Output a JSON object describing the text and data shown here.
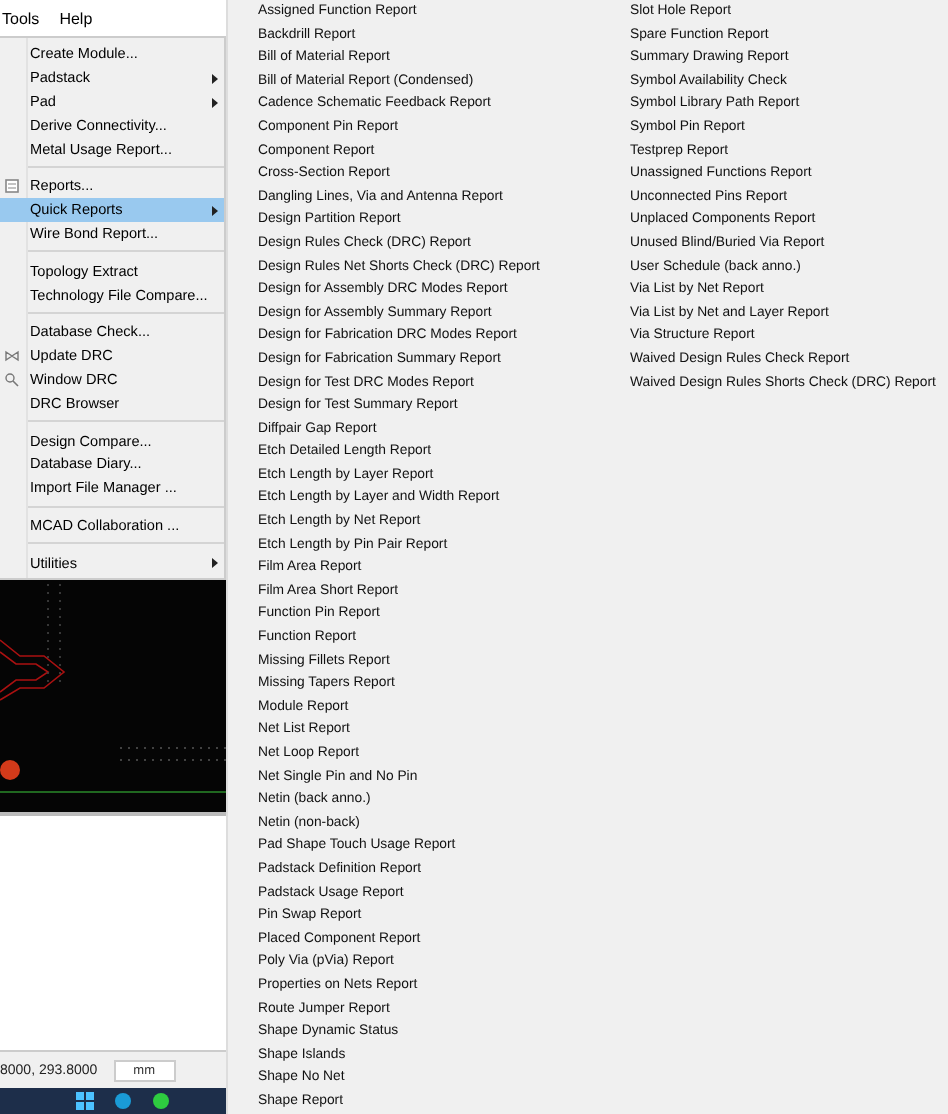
{
  "menubar": [
    {
      "label": "Tools"
    },
    {
      "label": "Help"
    }
  ],
  "tools_menu": {
    "groups": [
      [
        {
          "label": "Create Module...",
          "submenu": false,
          "selected": false,
          "has_icon": false
        },
        {
          "label": "Padstack",
          "submenu": true,
          "selected": false,
          "has_icon": false
        },
        {
          "label": "Pad",
          "submenu": true,
          "selected": false,
          "has_icon": false
        },
        {
          "label": "Derive Connectivity...",
          "submenu": false,
          "selected": false,
          "has_icon": false
        },
        {
          "label": "Metal Usage Report...",
          "submenu": false,
          "selected": false,
          "has_icon": false
        }
      ],
      [
        {
          "label": "Reports...",
          "submenu": false,
          "selected": false,
          "has_icon": true
        },
        {
          "label": "Quick Reports",
          "submenu": true,
          "selected": true,
          "has_icon": false
        },
        {
          "label": "Wire Bond Report...",
          "submenu": false,
          "selected": false,
          "has_icon": false
        }
      ],
      [
        {
          "label": "Topology Extract",
          "submenu": false,
          "selected": false,
          "has_icon": false
        },
        {
          "label": "Technology File Compare...",
          "submenu": false,
          "selected": false,
          "has_icon": false
        }
      ],
      [
        {
          "label": "Database Check...",
          "submenu": false,
          "selected": false,
          "has_icon": false
        },
        {
          "label": "Update DRC",
          "submenu": false,
          "selected": false,
          "has_icon": true
        },
        {
          "label": "Window DRC",
          "submenu": false,
          "selected": false,
          "has_icon": true
        },
        {
          "label": "DRC Browser",
          "submenu": false,
          "selected": false,
          "has_icon": false
        }
      ],
      [
        {
          "label": "Design Compare...",
          "submenu": false,
          "selected": false,
          "has_icon": false
        },
        {
          "label": "Database Diary...",
          "submenu": false,
          "selected": false,
          "has_icon": false
        },
        {
          "label": "Import File Manager ...",
          "submenu": false,
          "selected": false,
          "has_icon": false
        }
      ],
      [
        {
          "label": "MCAD Collaboration ...",
          "submenu": false,
          "selected": false,
          "has_icon": false
        }
      ],
      [
        {
          "label": "Utilities",
          "submenu": true,
          "selected": false,
          "has_icon": false
        }
      ]
    ]
  },
  "quick_reports": {
    "columns": [
      [
        "Assigned Function Report",
        "Backdrill Report",
        "Bill of Material Report",
        "Bill of Material Report (Condensed)",
        "Cadence Schematic Feedback Report",
        "Component Pin Report",
        "Component Report",
        "Cross-Section Report",
        "Dangling Lines, Via and Antenna Report",
        "Design Partition Report",
        "Design Rules Check (DRC) Report",
        "Design Rules Net Shorts Check (DRC) Report",
        "Design for Assembly DRC Modes Report",
        "Design for Assembly Summary Report",
        "Design for Fabrication DRC Modes Report",
        "Design for Fabrication Summary Report",
        "Design for Test DRC Modes Report",
        "Design for Test Summary Report",
        "Diffpair Gap Report",
        "Etch Detailed Length Report",
        "Etch Length by Layer Report",
        "Etch Length by Layer and Width Report",
        "Etch Length by Net Report",
        "Etch Length by Pin Pair Report",
        "Film Area Report",
        "Film Area Short Report",
        "Function Pin Report",
        "Function Report",
        "Missing Fillets Report",
        "Missing Tapers Report",
        "Module Report",
        "Net List Report",
        "Net Loop Report",
        "Net Single Pin and No Pin",
        "Netin (back anno.)",
        "Netin (non-back)",
        "Pad Shape Touch Usage Report",
        "Padstack Definition Report",
        "Padstack Usage Report",
        "Pin Swap Report",
        "Placed Component Report",
        "Poly Via (pVia) Report",
        "Properties on Nets Report",
        "Route Jumper Report",
        "Shape Dynamic Status",
        "Shape Islands",
        "Shape No Net",
        "Shape Report"
      ],
      [
        "Slot Hole Report",
        "Spare Function Report",
        "Summary Drawing Report",
        "Symbol Availability Check",
        "Symbol Library Path Report",
        "Symbol Pin Report",
        "Testprep Report",
        "Unassigned Functions Report",
        "Unconnected Pins Report",
        "Unplaced Components Report",
        "Unused Blind/Buried Via Report",
        "User Schedule (back anno.)",
        "Via List by Net Report",
        "Via List by Net and Layer Report",
        "Via Structure Report",
        "Waived Design Rules Check Report",
        "Waived Design Rules Shorts Check (DRC) Report"
      ]
    ]
  },
  "status_bar": {
    "coordinates": "8000, 293.8000",
    "units": "mm"
  }
}
